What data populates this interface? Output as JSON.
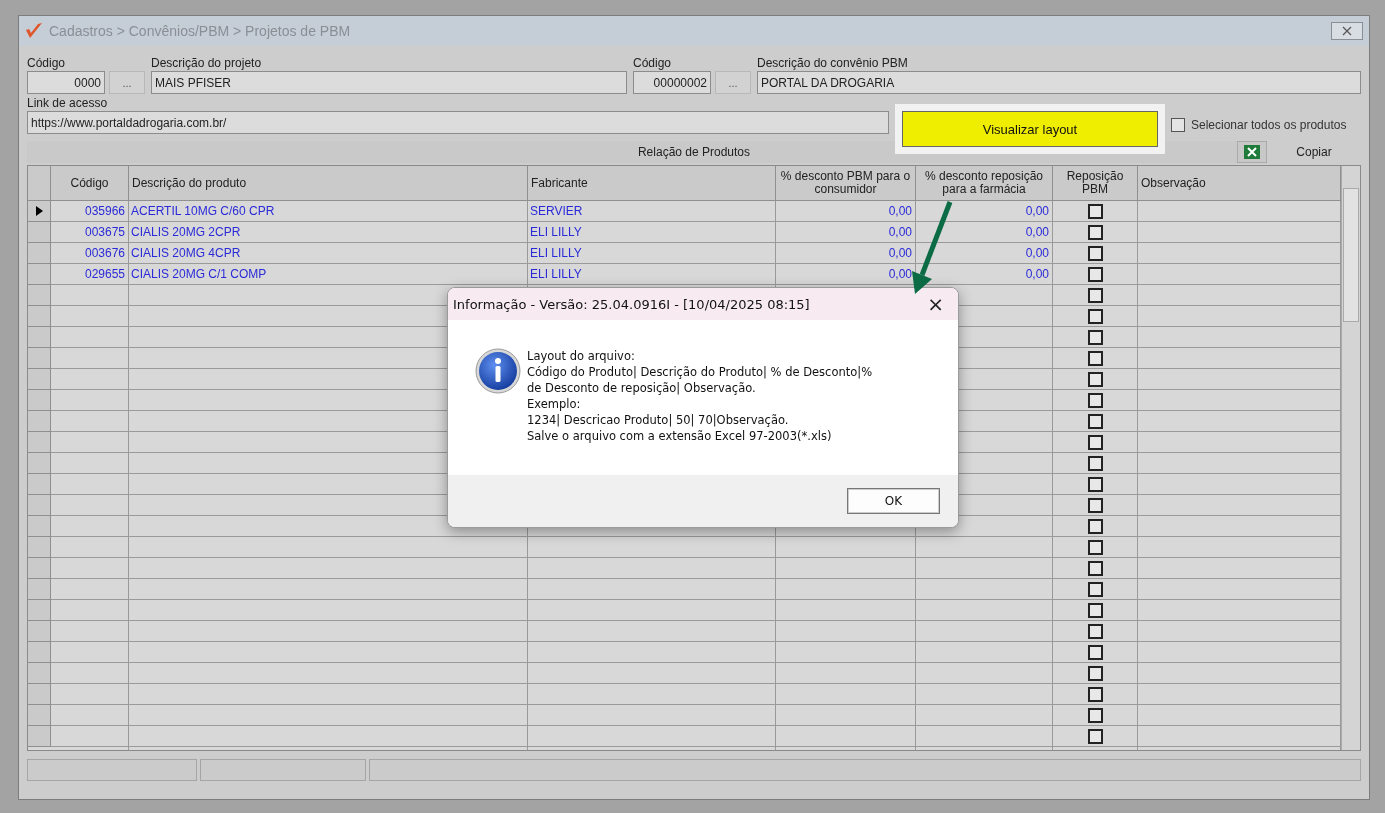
{
  "window": {
    "title": "Cadastros > Convênios/PBM > Projetos de PBM"
  },
  "form": {
    "codigo_label": "Código",
    "codigo_value": "0000",
    "lookup_button": "...",
    "descricao_label": "Descrição do projeto",
    "descricao_value": "MAIS PFISER",
    "convenio_codigo_label": "Código",
    "convenio_codigo_value": "00000002",
    "convenio_lookup_button": "...",
    "convenio_label": "Descrição do convênio PBM",
    "convenio_value": "PORTAL DA DROGARIA",
    "link_label": "Link de acesso",
    "link_value": "https://www.portaldadrogaria.com.br/",
    "layout_button": "Visualizar layout",
    "select_all": {
      "label": "Selecionar todos os produtos",
      "checked": false
    }
  },
  "products": {
    "title": "Relação de Produtos",
    "copy_button": "Copiar",
    "columns": [
      "Código",
      "Descrição do produto",
      "Fabricante",
      "% desconto PBM para o consumidor",
      "% desconto reposição para a farmácia",
      "Reposição PBM",
      "Observação"
    ],
    "rows": [
      {
        "selected": true,
        "code": "035966",
        "description": "ACERTIL 10MG C/60 CPR",
        "maker": "SERVIER",
        "discount": "0,00",
        "replacement": "0,00",
        "checked": false
      },
      {
        "selected": false,
        "code": "003675",
        "description": "CIALIS 20MG 2CPR",
        "maker": "ELI LILLY",
        "discount": "0,00",
        "replacement": "0,00",
        "checked": false
      },
      {
        "selected": false,
        "code": "003676",
        "description": "CIALIS 20MG 4CPR",
        "maker": "ELI LILLY",
        "discount": "0,00",
        "replacement": "0,00",
        "checked": false
      },
      {
        "selected": false,
        "code": "029655",
        "description": "CIALIS 20MG C/1 COMP",
        "maker": "ELI LILLY",
        "discount": "0,00",
        "replacement": "0,00",
        "checked": false
      },
      {
        "selected": false,
        "checked": false
      },
      {
        "selected": false,
        "checked": false
      },
      {
        "selected": false,
        "checked": false
      },
      {
        "selected": false,
        "checked": false
      },
      {
        "selected": false,
        "checked": false
      },
      {
        "selected": false,
        "checked": false
      },
      {
        "selected": false,
        "checked": false
      },
      {
        "selected": false,
        "checked": false
      },
      {
        "selected": false,
        "checked": false
      },
      {
        "selected": false,
        "checked": false
      },
      {
        "selected": false,
        "checked": false
      },
      {
        "selected": false,
        "checked": false
      },
      {
        "selected": false,
        "checked": false
      },
      {
        "selected": false,
        "checked": false
      },
      {
        "selected": false,
        "checked": false
      },
      {
        "selected": false,
        "checked": false
      },
      {
        "selected": false,
        "checked": false
      },
      {
        "selected": false,
        "checked": false
      },
      {
        "selected": false,
        "checked": false
      },
      {
        "selected": false,
        "checked": false
      },
      {
        "selected": false,
        "checked": false
      },
      {
        "selected": false,
        "checked": false
      }
    ]
  },
  "dialog": {
    "title": "Informação - Versão: 25.04.0916I - [10/04/2025 08:15]",
    "close": "×",
    "lines": [
      "Layout do arquivo:",
      "Código do Produto| Descrição do Produto| % de Desconto|%",
      "de Desconto de reposição| Observação.",
      "Exemplo:",
      "1234| Descricao Produto| 50| 70|Observação.",
      "Salve o arquivo com a extensão Excel 97-2003(*.xls)"
    ],
    "ok_button": "OK"
  }
}
